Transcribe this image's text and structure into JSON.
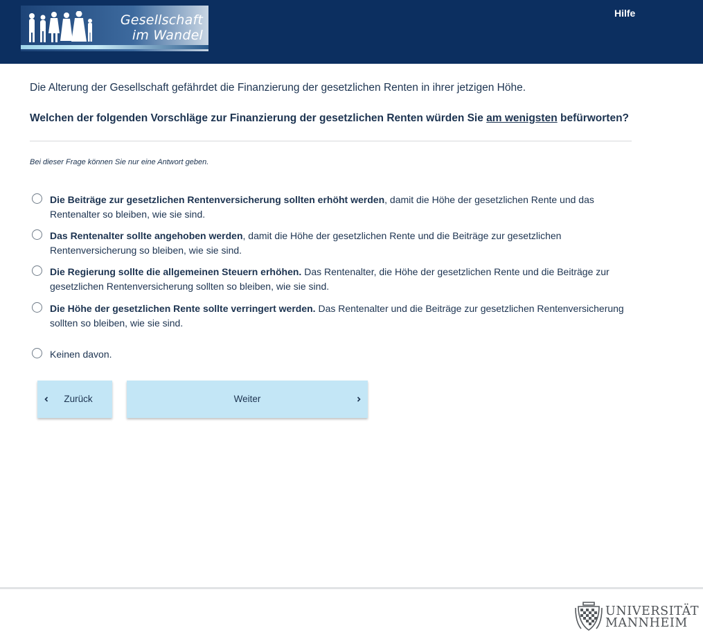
{
  "header": {
    "logo_line1": "Gesellschaft",
    "logo_line2": "im Wandel",
    "help_label": "Hilfe",
    "background_color": "#0c2f60"
  },
  "content": {
    "intro": "Die Alterung der Gesellschaft gefährdet die Finanzierung der gesetzlichen Renten in ihrer jetzigen Höhe.",
    "question_before": "Welchen der folgenden Vorschläge zur Finanzierung der gesetzlichen Renten würden Sie ",
    "question_emphasis": "am wenigsten",
    "question_after": " befürworten?",
    "hint": "Bei dieser Frage können Sie nur eine Antwort geben."
  },
  "options": [
    {
      "bold": "Die Beiträge zur gesetzlichen Rentenversicherung sollten erhöht werden",
      "rest": ", damit die Höhe der gesetzlichen Rente und das Rentenalter so bleiben, wie sie sind."
    },
    {
      "bold": "Das Rentenalter sollte angehoben werden",
      "rest": ", damit die Höhe der gesetzlichen Rente und die Beiträge zur gesetzlichen Rentenversicherung so bleiben, wie sie sind."
    },
    {
      "bold": "Die Regierung sollte die allgemeinen Steuern erhöhen.",
      "rest": " Das Rentenalter, die Höhe der gesetzlichen Rente und die Beiträge zur gesetzlichen Rentenversicherung sollten so bleiben, wie sie sind."
    },
    {
      "bold": "Die Höhe der gesetzlichen Rente sollte verringert werden.",
      "rest": " Das Rentenalter und die Beiträge zur gesetzlichen Rentenversicherung sollten so bleiben, wie sie sind."
    },
    {
      "bold": "",
      "rest": "Keinen davon."
    }
  ],
  "navigation": {
    "back_label": "Zurück",
    "next_label": "Weiter",
    "button_color": "#c3e6f6"
  },
  "footer": {
    "uni_line1": "UNIVERSITÄT",
    "uni_line2": "MANNHEIM"
  },
  "icons": {
    "back": "chevron-left-icon",
    "next": "chevron-right-icon"
  }
}
